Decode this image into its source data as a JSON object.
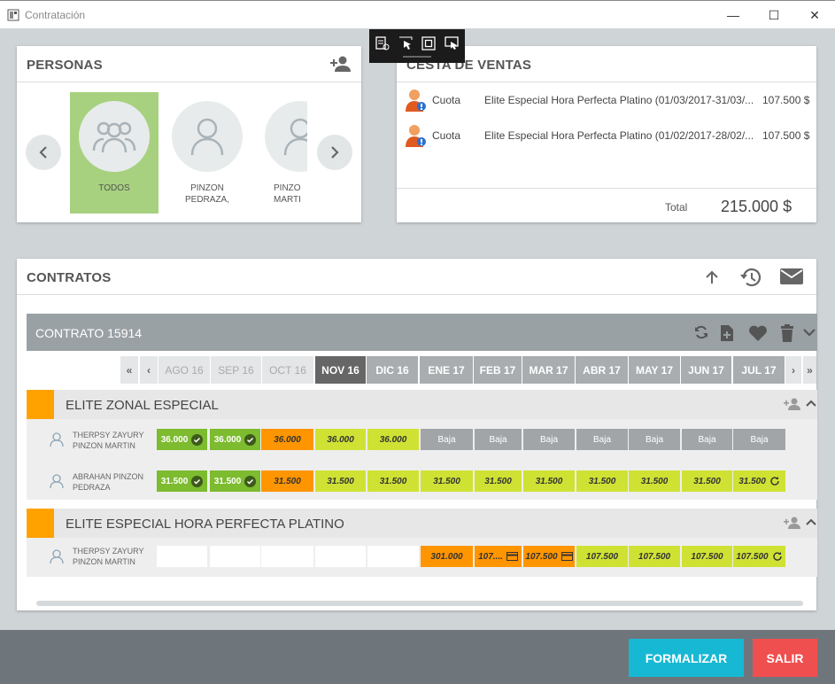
{
  "window": {
    "title": "Contratación",
    "minimize_glyph": "—",
    "maximize_glyph": "☐",
    "close_glyph": "✕"
  },
  "personas": {
    "title": "PERSONAS",
    "tiles": [
      {
        "name": "TODOS"
      },
      {
        "name": "PINZON PEDRAZA,"
      },
      {
        "name": "PINZO MARTI"
      }
    ]
  },
  "cesta": {
    "title": "CESTA DE VENTAS",
    "items": [
      {
        "type": "Cuota",
        "description": "Elite Especial Hora Perfecta Platino (01/03/2017-31/03/...",
        "amount": "107.500 $"
      },
      {
        "type": "Cuota",
        "description": "Elite Especial Hora Perfecta Platino (01/02/2017-28/02/...",
        "amount": "107.500 $"
      }
    ],
    "total_label": "Total",
    "total_value": "215.000 $"
  },
  "contratos": {
    "title": "CONTRATOS",
    "contract_title": "CONTRATO 15914",
    "months": [
      "AGO 16",
      "SEP 16",
      "OCT 16",
      "NOV 16",
      "DIC 16",
      "ENE 17",
      "FEB 17",
      "MAR 17",
      "ABR 17",
      "MAY 17",
      "JUN 17",
      "JUL 17"
    ],
    "groups": [
      {
        "title": "ELITE ZONAL ESPECIAL",
        "members": [
          {
            "name": "THERPSY ZAYURY PINZON MARTIN",
            "cells": [
              "36.000",
              "36.000",
              "36.000",
              "36.000",
              "36.000",
              "Baja",
              "Baja",
              "Baja",
              "Baja",
              "Baja",
              "Baja",
              "Baja"
            ]
          },
          {
            "name": "ABRAHAN PINZON PEDRAZA",
            "cells": [
              "31.500",
              "31.500",
              "31.500",
              "31.500",
              "31.500",
              "31.500",
              "31.500",
              "31.500",
              "31.500",
              "31.500",
              "31.500",
              "31.500"
            ]
          }
        ]
      },
      {
        "title": "ELITE ESPECIAL HORA PERFECTA PLATINO",
        "members": [
          {
            "name": "THERPSY ZAYURY PINZON MARTIN",
            "cells": [
              "",
              "",
              "",
              "",
              "",
              "301.000",
              "107....",
              "107.500",
              "107.500",
              "107.500",
              "107.500",
              "107.500"
            ]
          }
        ]
      }
    ]
  },
  "footer": {
    "formalizar": "FORMALIZAR",
    "salir": "SALIR"
  },
  "colors": {
    "paid_green": "#7dbb2f",
    "overdue_orange": "#ff9500",
    "pending_yellow": "#cfe234",
    "baja_gray": "#a2a5a8",
    "group_flag": "#ffa200",
    "formalizar_bg": "#17b8d3",
    "salir_bg": "#f04f4f"
  }
}
